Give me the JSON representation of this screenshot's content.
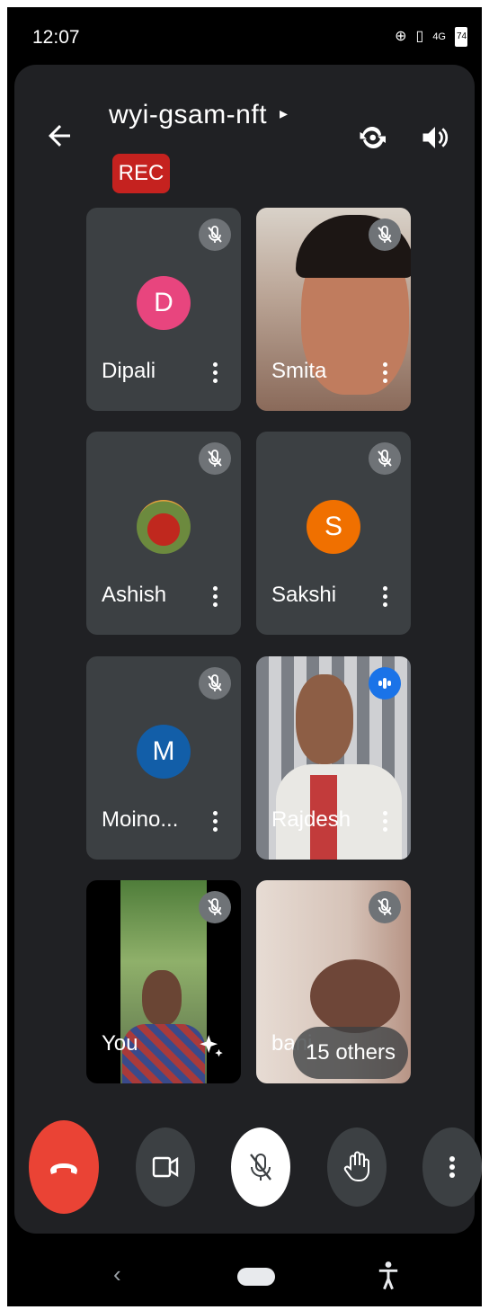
{
  "status_bar": {
    "time": "12:07",
    "signal_label": "4G",
    "battery": "74"
  },
  "header": {
    "meeting_code": "wyi-gsam-nft",
    "rec_label": "REC"
  },
  "participants": [
    {
      "name": "Dipali",
      "initial": "D",
      "avatar_color": "#e8457e",
      "muted": true
    },
    {
      "name": "Smita",
      "muted": true
    },
    {
      "name": "Ashish",
      "muted": true
    },
    {
      "name": "Sakshi",
      "initial": "S",
      "avatar_color": "#f07000",
      "muted": true
    },
    {
      "name": "Moino...",
      "initial": "M",
      "avatar_color": "#125ea8",
      "muted": true
    },
    {
      "name": "Rajdesh",
      "muted": false,
      "speaking": true
    },
    {
      "name": "You",
      "muted": true
    },
    {
      "name": "bani",
      "muted": true
    }
  ],
  "others_chip": {
    "label": "15 others"
  },
  "colors": {
    "end_call": "#ea4335",
    "rec": "#c5221f",
    "surface": "#202124",
    "tile": "#3c4043"
  }
}
